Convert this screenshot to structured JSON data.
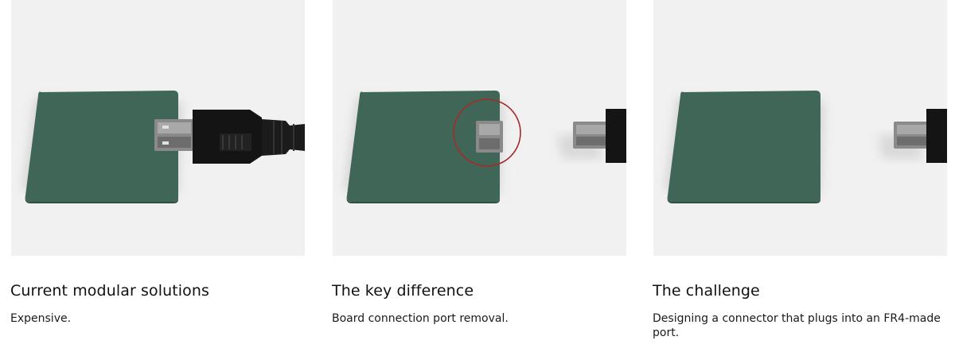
{
  "cards": [
    {
      "title": "Current modular solutions",
      "description": "Expensive."
    },
    {
      "title": "The key difference",
      "description": "Board connection port removal."
    },
    {
      "title": "The challenge",
      "description": "Designing a connector that plugs into an FR4-made port."
    }
  ],
  "colors": {
    "panel_background": "#f1f1f1",
    "board_green": "#3f6657",
    "cable_black": "#141414",
    "connector_metal": "#7a7a7a",
    "highlight_circle": "#a52a2a"
  }
}
